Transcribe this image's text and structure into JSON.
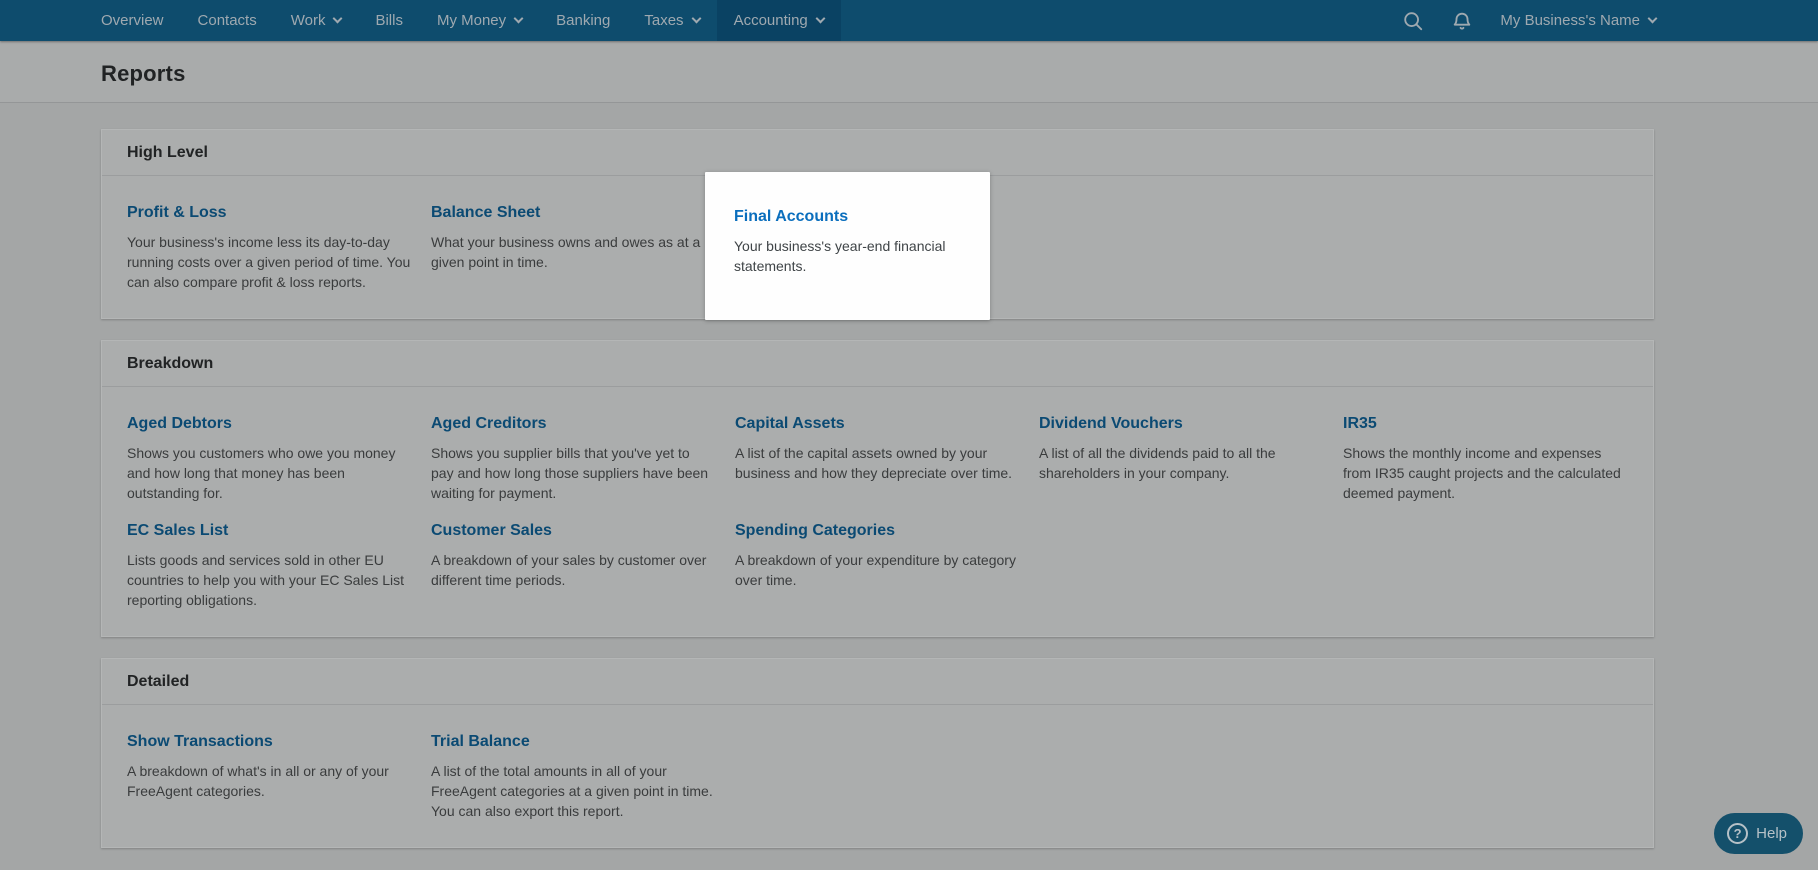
{
  "nav": {
    "items": [
      {
        "label": "Overview"
      },
      {
        "label": "Contacts"
      },
      {
        "label": "Work"
      },
      {
        "label": "Bills"
      },
      {
        "label": "My Money"
      },
      {
        "label": "Banking"
      },
      {
        "label": "Taxes"
      },
      {
        "label": "Accounting"
      }
    ],
    "business_name": "My Business's Name"
  },
  "page": {
    "title": "Reports"
  },
  "sections": [
    {
      "title": "High Level",
      "reports": [
        {
          "name": "Profit & Loss",
          "description": "Your business's income less its day-to-day\nrunning costs over a given period of time. You\ncan also compare profit & loss reports."
        },
        {
          "name": "Balance Sheet",
          "description": "What your business owns and owes as at a\ngiven point in time."
        },
        {
          "name": "Final Accounts",
          "description": "Your business's year-end financial\nstatements.",
          "highlighted": true
        }
      ]
    },
    {
      "title": "Breakdown",
      "reports": [
        {
          "name": "Aged Debtors",
          "description": "Shows you customers who owe you money\nand how long that money has been\noutstanding for."
        },
        {
          "name": "Aged Creditors",
          "description": "Shows you supplier bills that you've yet to\npay and how long those suppliers have been\nwaiting for payment."
        },
        {
          "name": "Capital Assets",
          "description": "A list of the capital assets owned by your\nbusiness and how they depreciate over time."
        },
        {
          "name": "Dividend Vouchers",
          "description": "A list of all the dividends paid to all the\nshareholders in your company."
        },
        {
          "name": "IR35",
          "description": "Shows the monthly income and expenses\nfrom IR35 caught projects and the calculated\ndeemed payment."
        },
        {
          "name": "EC Sales List",
          "description": "Lists goods and services sold in other EU\ncountries to help you with your EC Sales List\nreporting obligations."
        },
        {
          "name": "Customer Sales",
          "description": "A breakdown of your sales by customer over\ndifferent time periods."
        },
        {
          "name": "Spending Categories",
          "description": "A breakdown of your expenditure by category\nover time."
        }
      ]
    },
    {
      "title": "Detailed",
      "reports": [
        {
          "name": "Show Transactions",
          "description": "A breakdown of what's in all or any of your\nFreeAgent categories."
        },
        {
          "name": "Trial Balance",
          "description": "A list of the total amounts in all of your\nFreeAgent categories at a given point in time.\nYou can also export this report."
        }
      ]
    }
  ],
  "help": {
    "label": "Help"
  },
  "icons": {
    "search": "search-icon",
    "bell": "notifications-bell-icon",
    "chevron": "chevron-down-icon",
    "help": "question-mark-icon"
  },
  "colors": {
    "nav_bg": "#0e4c6d",
    "nav_active_bg": "#0a4263",
    "nav_text": "#9fa9b0",
    "header_bg": "#a9abab",
    "page_bg": "#a4a6a6",
    "card_bg": "#abadad",
    "card_border": "#b4b6b6",
    "divider": "#9b9d9e",
    "heading_text": "#212324",
    "link_dimmed": "#0b4a73",
    "text_dimmed": "#3a3c3d",
    "link_accent": "#0a6ebd",
    "text_body": "#3f4447",
    "spotlight_bg": "#fefefe",
    "help_bg": "#14506b",
    "help_text": "#b6c1c7"
  }
}
